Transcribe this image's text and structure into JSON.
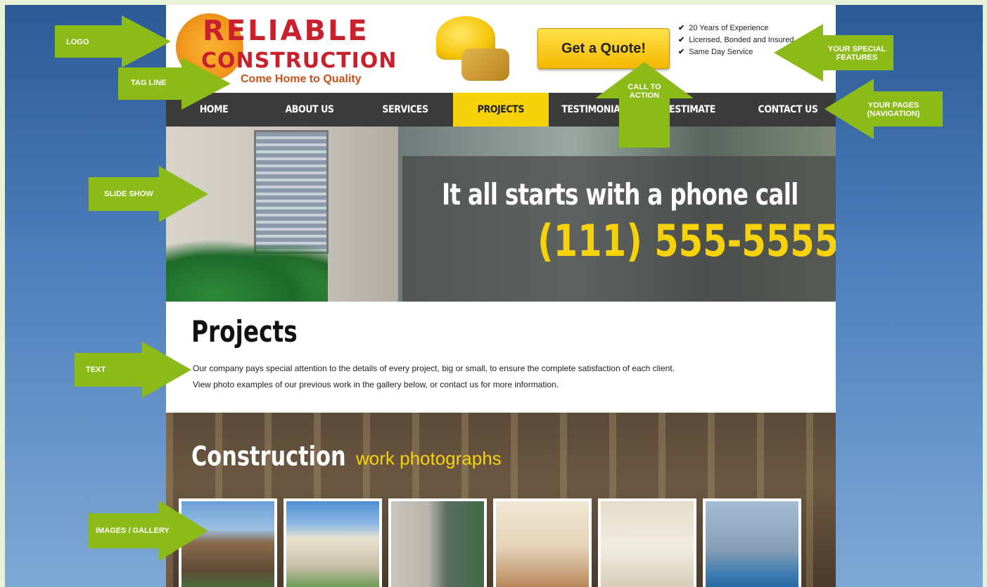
{
  "site": {
    "logo": {
      "line1": "RELIABLE",
      "line2": "CONSTRUCTION"
    },
    "tagline": "Come Home to Quality",
    "cta_label": "Get a Quote!",
    "features": [
      "20 Years of Experience",
      "Licensed, Bonded and Insured",
      "Same Day Service"
    ],
    "nav": [
      {
        "label": "HOME",
        "active": false
      },
      {
        "label": "ABOUT US",
        "active": false
      },
      {
        "label": "SERVICES",
        "active": false
      },
      {
        "label": "PROJECTS",
        "active": true
      },
      {
        "label": "TESTIMONIALS",
        "active": false
      },
      {
        "label": "ESTIMATE",
        "active": false
      },
      {
        "label": "CONTACT US",
        "active": false
      }
    ],
    "slide": {
      "line1": "It all starts with a phone call",
      "phone": "(111) 555-5555"
    },
    "content": {
      "title": "Projects",
      "para1": "Our company pays special attention to the details of every project, big or small, to ensure the complete satisfaction of each client.",
      "para2": "View photo examples of our previous work in the gallery below, or contact us for more information."
    },
    "gallery": {
      "title": "Construction",
      "subtitle": "work photographs"
    }
  },
  "annotations": {
    "logo": "LOGO",
    "tagline": "TAG LINE",
    "special_features": "YOUR SPECIAL FEATURES",
    "call_to_action": "CALL TO ACTION",
    "pages": "YOUR PAGES (NAVIGATION)",
    "slide_show": "SLIDE SHOW",
    "text": "TEXT",
    "gallery": "IMAGES / GALLERY"
  },
  "colors": {
    "arrow": "#8cba18",
    "accent": "#f6d20a",
    "logo_red": "#c8202c",
    "nav_bg": "#3b3b3b"
  }
}
